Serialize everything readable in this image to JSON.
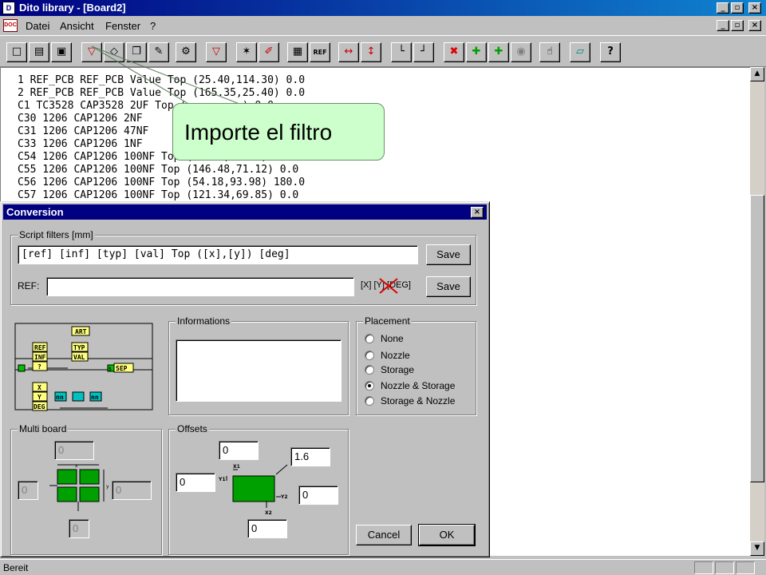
{
  "window": {
    "title": "Dito library - [Board2]",
    "controls": {
      "minimize": "_",
      "maximize": "°",
      "close": "×"
    }
  },
  "menu": {
    "items": [
      {
        "label": "Datei"
      },
      {
        "label": "Ansicht"
      },
      {
        "label": "Fenster"
      },
      {
        "label": "?"
      }
    ]
  },
  "toolbar": {
    "buttons": [
      {
        "icon": "new-file-icon",
        "glyph": "□"
      },
      {
        "icon": "open-folder-icon",
        "glyph": "▤"
      },
      {
        "icon": "save-disk-icon",
        "glyph": "▣"
      },
      {
        "icon": "filter-funnel-icon",
        "glyph": "▽"
      },
      {
        "icon": "diamond-filter-icon",
        "glyph": "◇"
      },
      {
        "icon": "copy-icon",
        "glyph": "❐"
      },
      {
        "icon": "edit-icon",
        "glyph": "✎"
      },
      {
        "icon": "gear-icon",
        "glyph": "⚙"
      },
      {
        "icon": "funnel-icon",
        "glyph": "▽"
      },
      {
        "icon": "wand-icon",
        "glyph": "✶"
      },
      {
        "icon": "brush-icon",
        "glyph": "✐"
      },
      {
        "icon": "grid-icon",
        "glyph": "▦"
      },
      {
        "icon": "ref-icon",
        "glyph": "REF"
      },
      {
        "icon": "move-horizontal-icon",
        "glyph": "↔"
      },
      {
        "icon": "move-vertical-icon",
        "glyph": "↕"
      },
      {
        "icon": "axis-x-icon",
        "glyph": "└"
      },
      {
        "icon": "axis-y-icon",
        "glyph": "┘"
      },
      {
        "icon": "delete-x-icon",
        "glyph": "✖"
      },
      {
        "icon": "green-plus-icon",
        "glyph": "✚"
      },
      {
        "icon": "green-plus-2-icon",
        "glyph": "✚"
      },
      {
        "icon": "eye-icon",
        "glyph": "◉"
      },
      {
        "icon": "hand-icon",
        "glyph": "☝"
      },
      {
        "icon": "eraser-icon",
        "glyph": "▱"
      },
      {
        "icon": "help-icon",
        "glyph": "?"
      }
    ]
  },
  "document": {
    "lines": [
      "1 REF_PCB REF_PCB Value Top (25.40,114.30) 0.0",
      "2 REF_PCB REF_PCB Value Top (165.35,25.40) 0.0",
      "C1 TC3528 CAP3528 2UF Top (         ) 0.0",
      "C30 1206 CAP1206 2NF",
      "C31 1206 CAP1206 47NF",
      "C33 1206 CAP1206 1NF",
      "C54 1206 CAP1206 100NF Top (37.98,71.12) 0.0",
      "C55 1206 CAP1206 100NF Top (146.48,71.12) 0.0",
      "C56 1206 CAP1206 100NF Top (54.18,93.98) 180.0",
      "C57 1206 CAP1206 100NF Top (121.34,69.85) 0.0"
    ]
  },
  "callout": {
    "text": "Importe el filtro"
  },
  "dialog": {
    "title": "Conversion",
    "close": "×",
    "script_filters": {
      "label": "Script filters [mm]",
      "filter_value": "[ref] [inf] [typ] [val] Top ([x],[y]) [deg]",
      "save1": "Save",
      "ref_label": "REF:",
      "ref_value": "",
      "coords_hint": "[X] [Y] [DEG]",
      "save2": "Save"
    },
    "diagram": {
      "blocks": [
        "ART",
        "REF",
        "TYP",
        "INF",
        "VAL",
        "?",
        "SEP",
        "X",
        "Y",
        "DEG",
        "nn",
        "nn",
        "S"
      ]
    },
    "informations": {
      "label": "Informations",
      "value": ""
    },
    "placement": {
      "label": "Placement",
      "options": [
        {
          "label": "None",
          "checked": false
        },
        {
          "label": "Nozzle",
          "checked": false
        },
        {
          "label": "Storage",
          "checked": false
        },
        {
          "label": "Nozzle & Storage",
          "checked": true
        },
        {
          "label": "Storage & Nozzle",
          "checked": false
        }
      ]
    },
    "multiboard": {
      "label": "Multi board",
      "top": "0",
      "left": "0",
      "right": "0",
      "bottom": "0",
      "dim_x": "x",
      "dim_y": "y"
    },
    "offsets": {
      "label": "Offsets",
      "top": "0",
      "angle": "1.6",
      "left": "0",
      "right": "0",
      "bottom": "0",
      "labels": {
        "x1": "X1",
        "y1": "Y1",
        "y2": "Y2",
        "x2": "X2"
      }
    },
    "cancel": "Cancel",
    "ok": "OK"
  },
  "status": {
    "text": "Bereit"
  },
  "colors": {
    "title_bar": "#000080",
    "callout_bg": "#ccffcc",
    "diagram_block": "#ffff80",
    "diagram_green": "#00c000",
    "diagram_cyan": "#00c0c0",
    "pcb_green": "#00a000"
  }
}
